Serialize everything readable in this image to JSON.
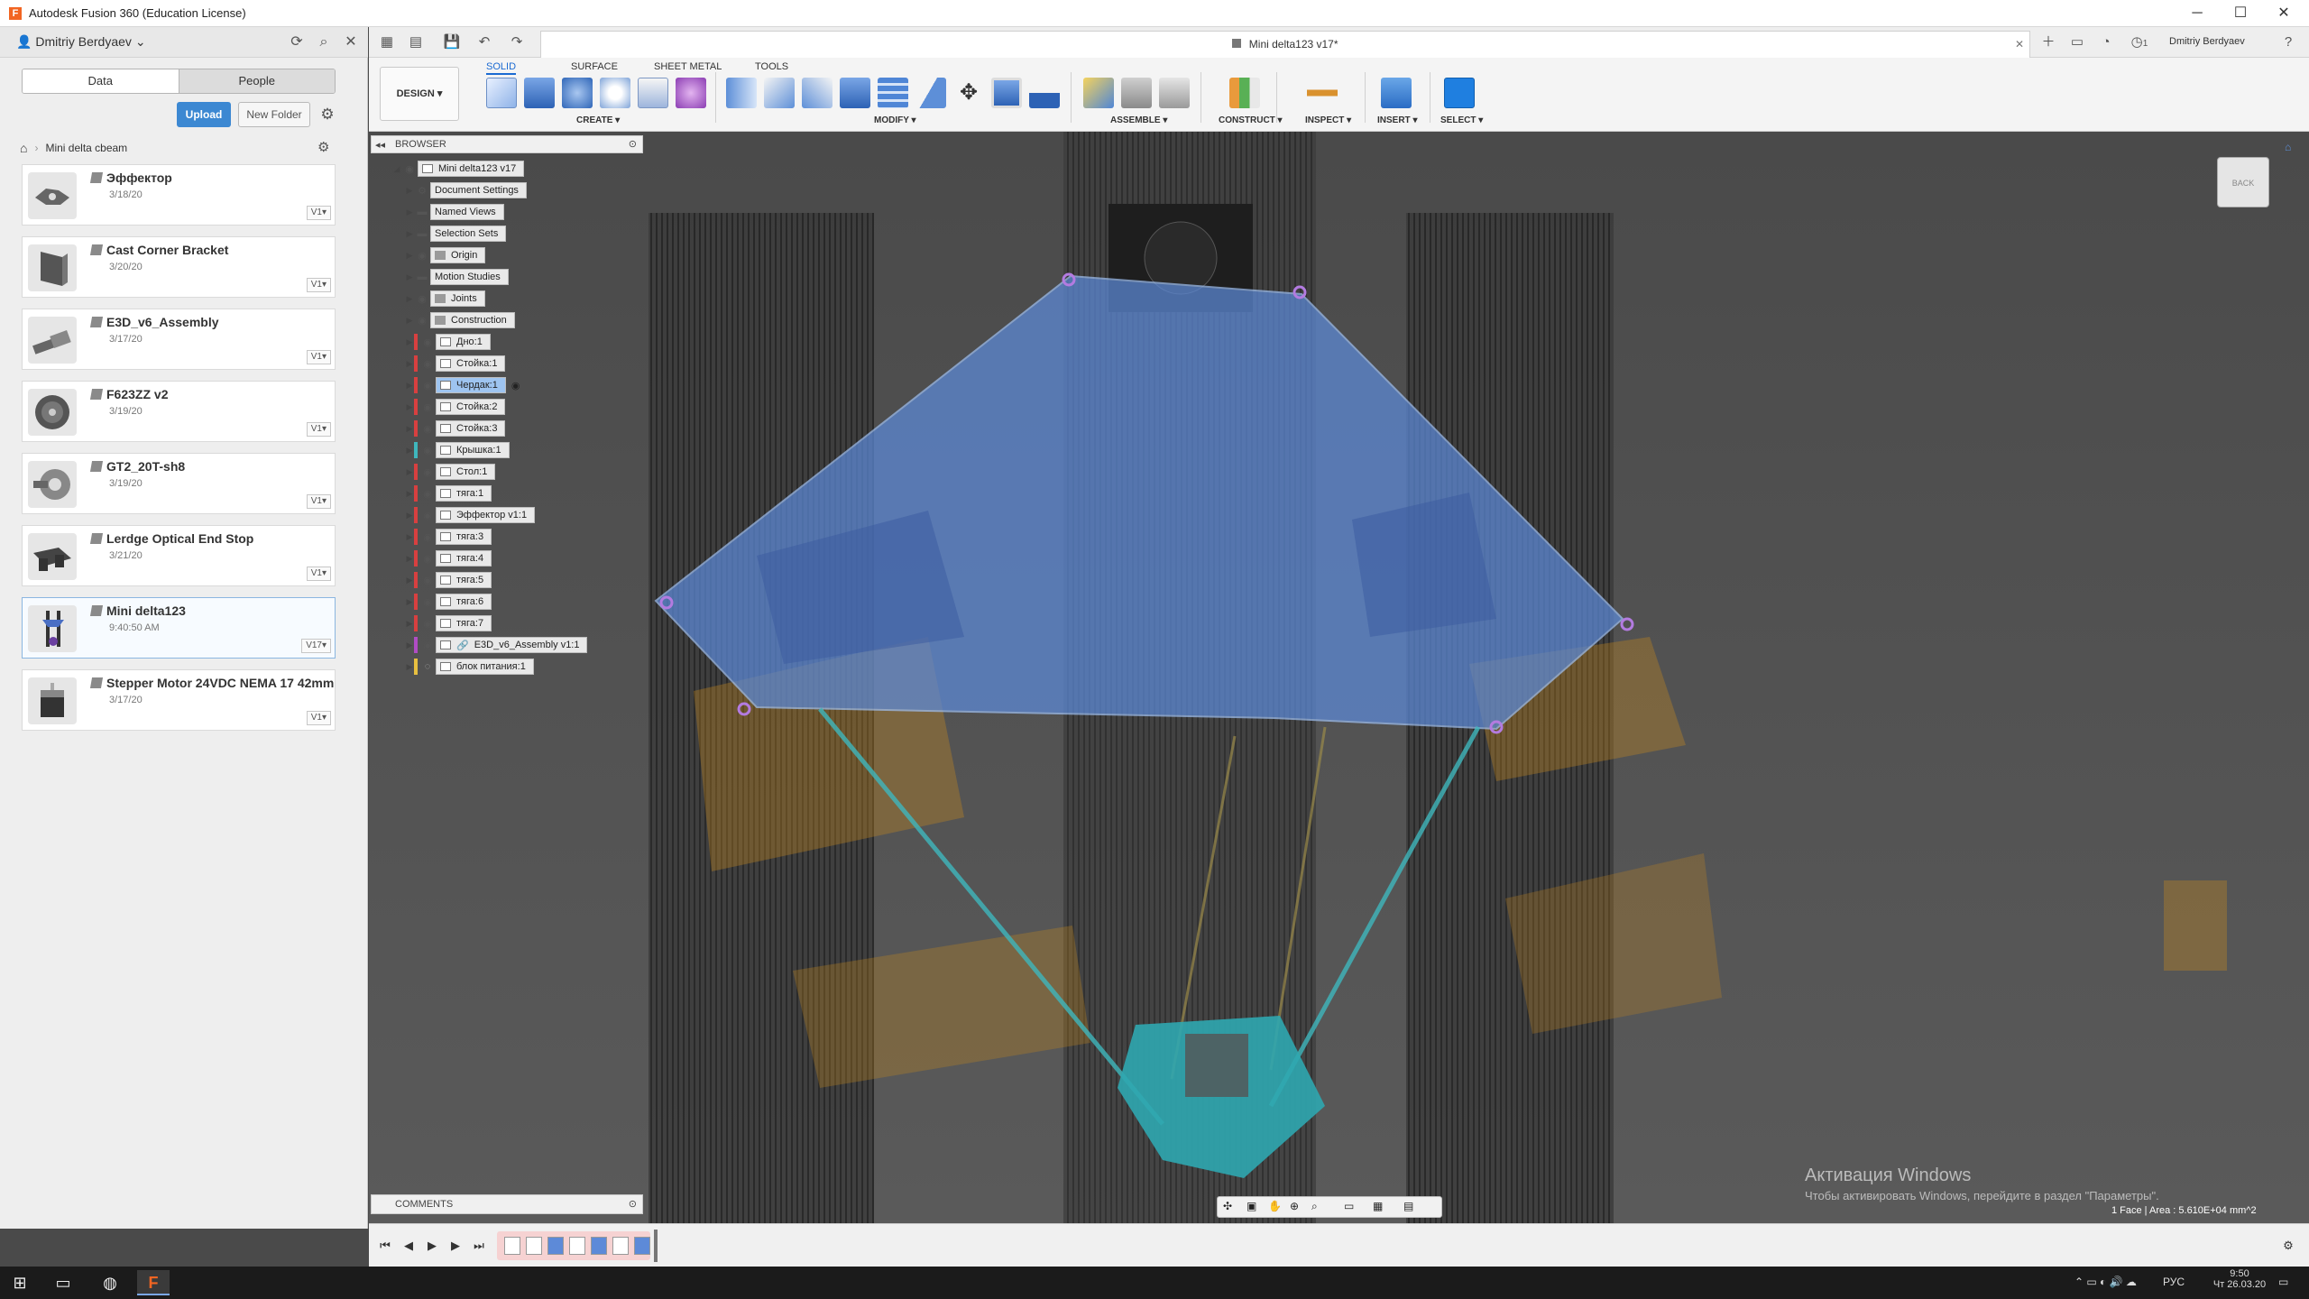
{
  "window": {
    "app_icon_letter": "F",
    "title": "Autodesk Fusion 360 (Education License)",
    "controls": {
      "minimize": "─",
      "maximize": "☐",
      "close": "✕"
    }
  },
  "data_panel": {
    "user_name": "Dmitriy Berdyaev",
    "tabs": {
      "data": "Data",
      "people": "People"
    },
    "upload_label": "Upload",
    "new_folder_label": "New Folder",
    "breadcrumb": "Mini delta cbeam",
    "items": [
      {
        "name": "Эффектор",
        "date": "3/18/20",
        "version": "V1▾"
      },
      {
        "name": "Cast Corner Bracket",
        "date": "3/20/20",
        "version": "V1▾"
      },
      {
        "name": "E3D_v6_Assembly",
        "date": "3/17/20",
        "version": "V1▾"
      },
      {
        "name": "F623ZZ v2",
        "date": "3/19/20",
        "version": "V1▾"
      },
      {
        "name": "GT2_20T-sh8",
        "date": "3/19/20",
        "version": "V1▾"
      },
      {
        "name": "Lerdge Optical End Stop",
        "date": "3/21/20",
        "version": "V1▾"
      },
      {
        "name": "Mini delta123",
        "date": "9:40:50 AM",
        "version": "V17▾"
      },
      {
        "name": "Stepper Motor 24VDC NEMA 17 42mm",
        "date": "3/17/20",
        "version": "V1▾"
      }
    ]
  },
  "toolbar": {
    "document_tab": "Mini delta123 v17*",
    "user": "Dmitriy Berdyaev",
    "notif_count": "1",
    "workspace": "DESIGN ▾",
    "tabs": {
      "solid": "SOLID",
      "surface": "SURFACE",
      "sheet_metal": "SHEET METAL",
      "tools": "TOOLS"
    },
    "groups": {
      "create": "CREATE ▾",
      "modify": "MODIFY ▾",
      "assemble": "ASSEMBLE ▾",
      "construct": "CONSTRUCT ▾",
      "inspect": "INSPECT ▾",
      "insert": "INSERT ▾",
      "select": "SELECT ▾"
    }
  },
  "browser": {
    "title": "BROWSER",
    "root": "Mini delta123 v17",
    "nodes": [
      "Document Settings",
      "Named Views",
      "Selection Sets",
      "Origin",
      "Motion Studies",
      "Joints",
      "Construction",
      "Дно:1",
      "Стойка:1",
      "Чердак:1",
      "Стойка:2",
      "Стойка:3",
      "Крышка:1",
      "Стол:1",
      "тяга:1",
      "Эффектор v1:1",
      "тяга:3",
      "тяга:4",
      "тяга:5",
      "тяга:6",
      "тяга:7",
      "E3D_v6_Assembly v1:1",
      "блок питания:1"
    ],
    "comments_label": "COMMENTS"
  },
  "viewport": {
    "viewcube_label": "BACK",
    "watermark_title": "Активация Windows",
    "watermark_text": "Чтобы активировать Windows, перейдите в раздел \"Параметры\".",
    "selection_status": "1 Face | Area : 5.610E+04 mm^2"
  },
  "taskbar": {
    "lang": "РУС",
    "time": "9:50",
    "date": "Чт 26.03.20"
  }
}
